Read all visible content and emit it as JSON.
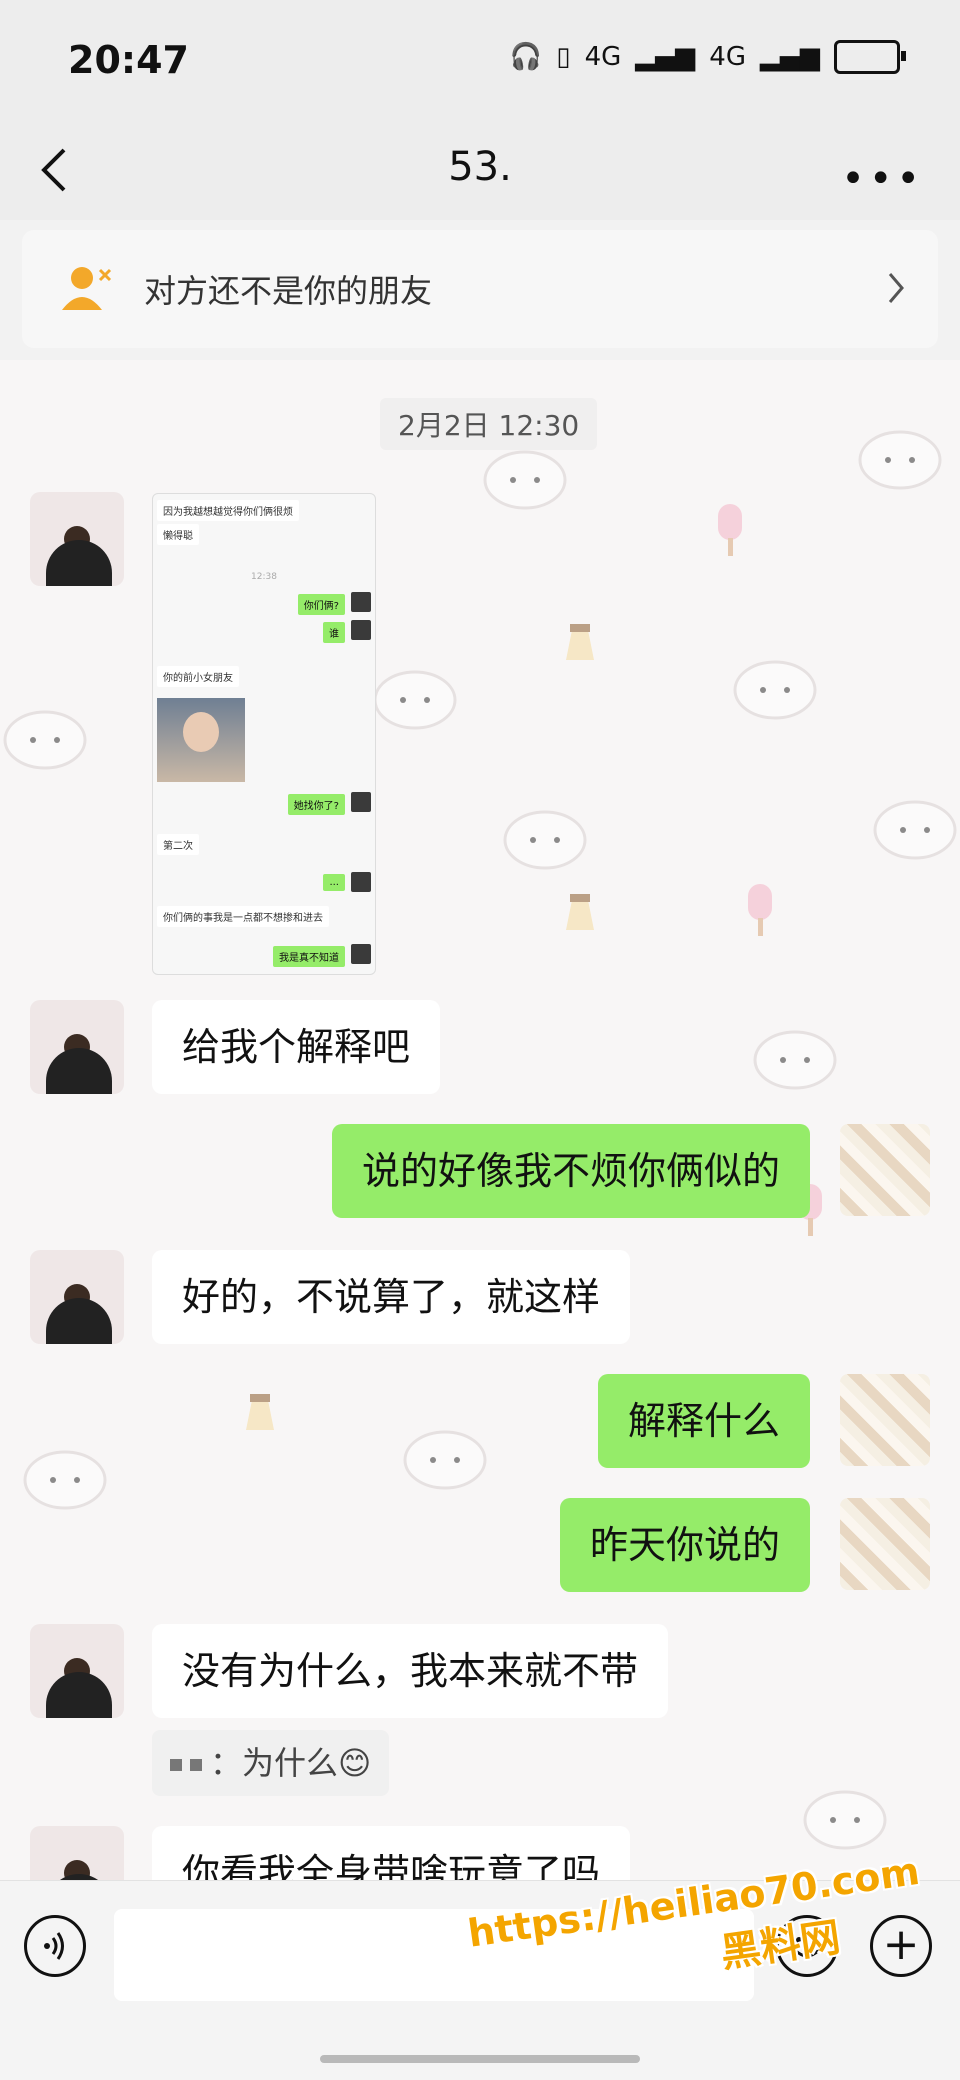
{
  "status": {
    "time": "20:47",
    "net1": "4G",
    "net2": "4G"
  },
  "header": {
    "title": "53."
  },
  "banner": {
    "text": "对方还不是你的朋友"
  },
  "chat": {
    "timestamp": "2月2日 12:30",
    "shared_screenshot": {
      "lines": [
        "因为我越想越觉得你们俩很烦",
        "懒得聪",
        "你们俩?",
        "谁",
        "你的前小女朋友",
        "她找你了?",
        "第二次",
        "...",
        "你们俩的事我是一点都不想掺和进去",
        "我是真不知道"
      ],
      "time": "12:38"
    },
    "messages": [
      {
        "side": "left",
        "text": "给我个解释吧"
      },
      {
        "side": "right",
        "text": "说的好像我不烦你俩似的"
      },
      {
        "side": "left",
        "text": "好的，不说算了，就这样"
      },
      {
        "side": "right",
        "text": "解释什么"
      },
      {
        "side": "right",
        "text": "昨天你说的"
      },
      {
        "side": "left",
        "text": "没有为什么，我本来就不带"
      },
      {
        "side": "left",
        "text": "你看我全身带啥玩意了吗"
      }
    ],
    "quote": {
      "sep": "：",
      "text": "为什么",
      "emoji": "😊"
    }
  },
  "watermark": {
    "url": "https://heiliao70.com",
    "cn": "黑料网"
  }
}
